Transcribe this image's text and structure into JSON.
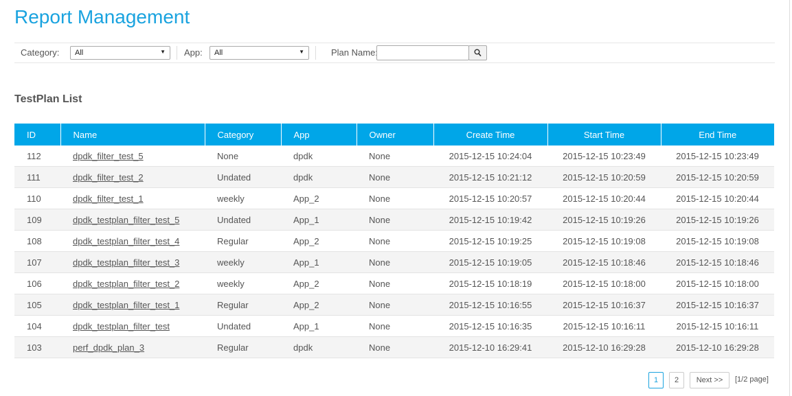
{
  "page": {
    "title": "Report Management"
  },
  "filters": {
    "category_label": "Category:",
    "category_value": "All",
    "app_label": "App:",
    "app_value": "All",
    "plan_name_label": "Plan Name:",
    "plan_name_value": "",
    "search_icon": "search-icon"
  },
  "section": {
    "title": "TestPlan List"
  },
  "table": {
    "header_color": "#00a6e8",
    "columns": [
      "ID",
      "Name",
      "Category",
      "App",
      "Owner",
      "Create Time",
      "Start Time",
      "End Time"
    ],
    "rows": [
      {
        "id": "112",
        "name": "dpdk_filter_test_5",
        "category": "None",
        "app": "dpdk",
        "owner": "None",
        "create_time": "2015-12-15 10:24:04",
        "start_time": "2015-12-15 10:23:49",
        "end_time": "2015-12-15 10:23:49"
      },
      {
        "id": "111",
        "name": "dpdk_filter_test_2",
        "category": "Undated",
        "app": "dpdk",
        "owner": "None",
        "create_time": "2015-12-15 10:21:12",
        "start_time": "2015-12-15 10:20:59",
        "end_time": "2015-12-15 10:20:59"
      },
      {
        "id": "110",
        "name": "dpdk_filter_test_1",
        "category": "weekly",
        "app": "App_2",
        "owner": "None",
        "create_time": "2015-12-15 10:20:57",
        "start_time": "2015-12-15 10:20:44",
        "end_time": "2015-12-15 10:20:44"
      },
      {
        "id": "109",
        "name": "dpdk_testplan_filter_test_5",
        "category": "Undated",
        "app": "App_1",
        "owner": "None",
        "create_time": "2015-12-15 10:19:42",
        "start_time": "2015-12-15 10:19:26",
        "end_time": "2015-12-15 10:19:26"
      },
      {
        "id": "108",
        "name": "dpdk_testplan_filter_test_4",
        "category": "Regular",
        "app": "App_2",
        "owner": "None",
        "create_time": "2015-12-15 10:19:25",
        "start_time": "2015-12-15 10:19:08",
        "end_time": "2015-12-15 10:19:08"
      },
      {
        "id": "107",
        "name": "dpdk_testplan_filter_test_3",
        "category": "weekly",
        "app": "App_1",
        "owner": "None",
        "create_time": "2015-12-15 10:19:05",
        "start_time": "2015-12-15 10:18:46",
        "end_time": "2015-12-15 10:18:46"
      },
      {
        "id": "106",
        "name": "dpdk_testplan_filter_test_2",
        "category": "weekly",
        "app": "App_2",
        "owner": "None",
        "create_time": "2015-12-15 10:18:19",
        "start_time": "2015-12-15 10:18:00",
        "end_time": "2015-12-15 10:18:00"
      },
      {
        "id": "105",
        "name": "dpdk_testplan_filter_test_1",
        "category": "Regular",
        "app": "App_2",
        "owner": "None",
        "create_time": "2015-12-15 10:16:55",
        "start_time": "2015-12-15 10:16:37",
        "end_time": "2015-12-15 10:16:37"
      },
      {
        "id": "104",
        "name": "dpdk_testplan_filter_test",
        "category": "Undated",
        "app": "App_1",
        "owner": "None",
        "create_time": "2015-12-15 10:16:35",
        "start_time": "2015-12-15 10:16:11",
        "end_time": "2015-12-15 10:16:11"
      },
      {
        "id": "103",
        "name": "perf_dpdk_plan_3",
        "category": "Regular",
        "app": "dpdk",
        "owner": "None",
        "create_time": "2015-12-10 16:29:41",
        "start_time": "2015-12-10 16:29:28",
        "end_time": "2015-12-10 16:29:28"
      }
    ]
  },
  "pagination": {
    "pages": [
      "1",
      "2"
    ],
    "current_page": "1",
    "next_label": "Next >>",
    "info": "[1/2 page]"
  },
  "colors": {
    "accent": "#1aa3df",
    "row_alt": "#f4f4f4"
  }
}
